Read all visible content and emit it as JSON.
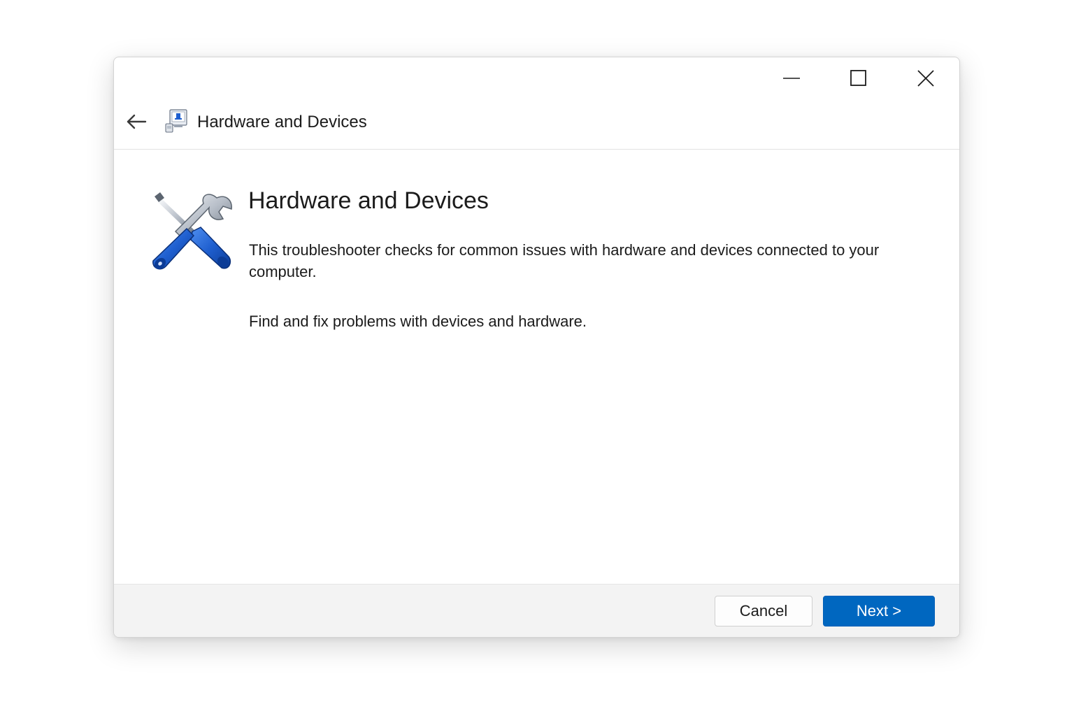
{
  "window": {
    "title": "Hardware and Devices",
    "controls": {
      "minimize_icon": "minimize-icon",
      "maximize_icon": "maximize-icon",
      "close_icon": "close-icon"
    }
  },
  "header": {
    "back_icon": "back-arrow-icon",
    "app_icon": "hardware-devices-icon",
    "title": "Hardware and Devices"
  },
  "content": {
    "icon": "screwdriver-wrench-icon",
    "heading": "Hardware and Devices",
    "description": "This troubleshooter checks for common issues with hardware and devices connected to your computer.",
    "subdescription": "Find and fix problems with devices and hardware."
  },
  "footer": {
    "cancel_label": "Cancel",
    "next_label": "Next >"
  },
  "colors": {
    "accent": "#0067c0",
    "footer_bg": "#f3f3f3",
    "icon_blue": "#1f5fcf"
  }
}
